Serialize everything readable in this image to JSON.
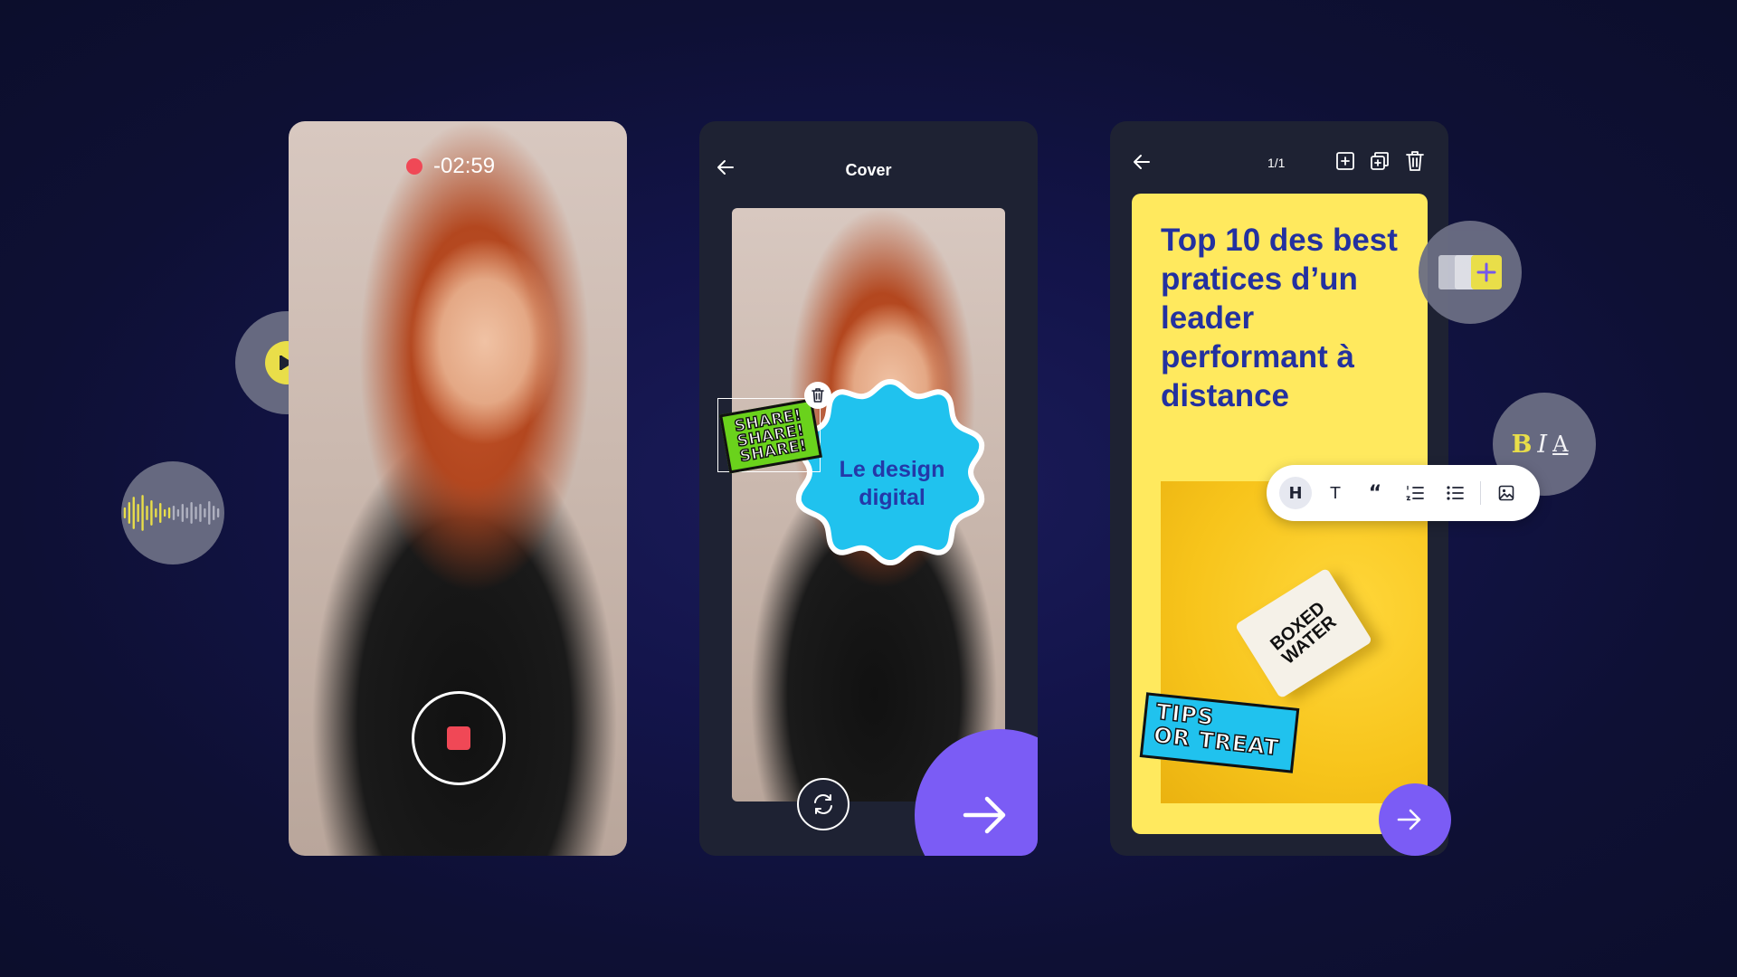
{
  "colors": {
    "background": "#12134a",
    "accent_purple": "#7b5cf5",
    "record_red": "#f04856",
    "card_yellow": "#ffe95e",
    "title_blue": "#2331a0",
    "sticker_blue": "#20c2ee",
    "sticker_green": "#6ad21c",
    "play_yellow": "#f5e94a"
  },
  "recorder": {
    "timer": "-02:59",
    "play_icon": "play-icon",
    "waveform_icon": "audio-waveform-icon",
    "stop_icon": "stop-record-icon"
  },
  "cover_editor": {
    "title": "Cover",
    "back_icon": "arrow-left-icon",
    "sticker_share": [
      "SHARE!",
      "SHARE!",
      "SHARE!"
    ],
    "sticker_badge_lines": [
      "Le design",
      "digital"
    ],
    "delete_icon": "trash-icon",
    "rotate_icon": "rotate-camera-icon",
    "next_icon": "arrow-right-icon"
  },
  "slide_editor": {
    "page_count": "1/1",
    "back_icon": "arrow-left-icon",
    "add_icon": "add-page-icon",
    "duplicate_icon": "duplicate-page-icon",
    "delete_icon": "trash-icon",
    "title": "Top 10 des best pratices d’un leader performant à distance",
    "carton_text": "BOXED WATER",
    "sticker_tips": [
      "TIPS",
      "OR TREAT"
    ],
    "next_icon": "arrow-right-icon",
    "add_layout_icon": "add-layout-icon"
  },
  "format_toolbar": {
    "heading": "H",
    "text": "T",
    "quote": "“",
    "numbered_list_icon": "numbered-list-icon",
    "bullet_list_icon": "bullet-list-icon",
    "image_icon": "image-icon"
  },
  "format_bubble": {
    "bold": "B",
    "italic": "I",
    "text_color": "A"
  }
}
